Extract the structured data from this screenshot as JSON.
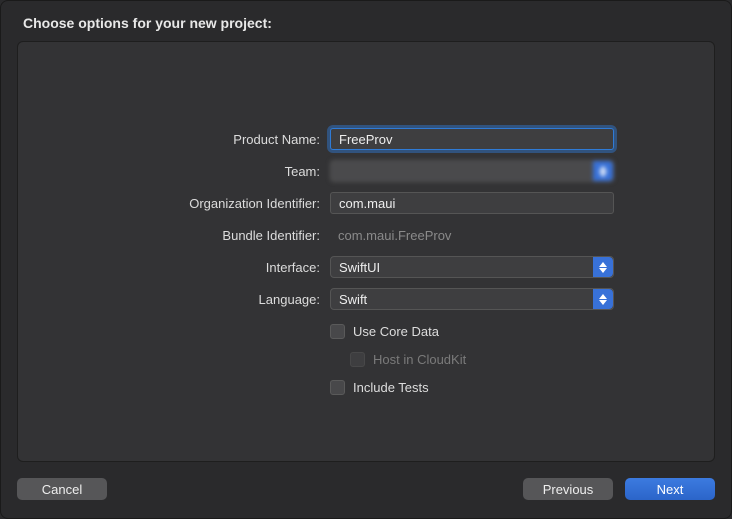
{
  "title": "Choose options for your new project:",
  "labels": {
    "product_name": "Product Name:",
    "team": "Team:",
    "org_identifier": "Organization Identifier:",
    "bundle_identifier": "Bundle Identifier:",
    "interface": "Interface:",
    "language": "Language:"
  },
  "values": {
    "product_name": "FreeProv",
    "team": "",
    "org_identifier": "com.maui",
    "bundle_identifier": "com.maui.FreeProv",
    "interface": "SwiftUI",
    "language": "Swift"
  },
  "checkboxes": {
    "use_core_data": {
      "label": "Use Core Data",
      "checked": false,
      "enabled": true
    },
    "host_cloudkit": {
      "label": "Host in CloudKit",
      "checked": false,
      "enabled": false
    },
    "include_tests": {
      "label": "Include Tests",
      "checked": false,
      "enabled": true
    }
  },
  "buttons": {
    "cancel": "Cancel",
    "previous": "Previous",
    "next": "Next"
  }
}
